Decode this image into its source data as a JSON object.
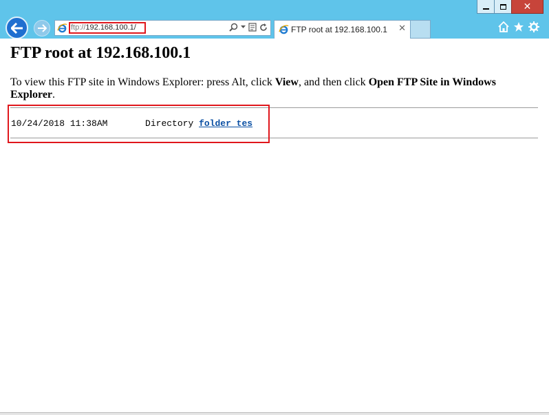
{
  "browser": {
    "address": {
      "protocol": "ftp://",
      "host_path": "192.168.100.1/"
    },
    "tab": {
      "title": "FTP root at 192.168.100.1"
    }
  },
  "page": {
    "title": "FTP root at 192.168.100.1",
    "instructions": {
      "part1": "To view this FTP site in Windows Explorer: press Alt, click ",
      "view": "View",
      "part2": ", and then click ",
      "open_site": "Open FTP Site in Windows Explorer",
      "part3": "."
    },
    "listing": [
      {
        "date": "10/24/2018",
        "time": "11:38AM",
        "type": "Directory",
        "name": "folder tes"
      }
    ]
  },
  "colors": {
    "frame": "#5fc4ea",
    "highlight": "#e0161b",
    "link": "#0a4fa3"
  }
}
